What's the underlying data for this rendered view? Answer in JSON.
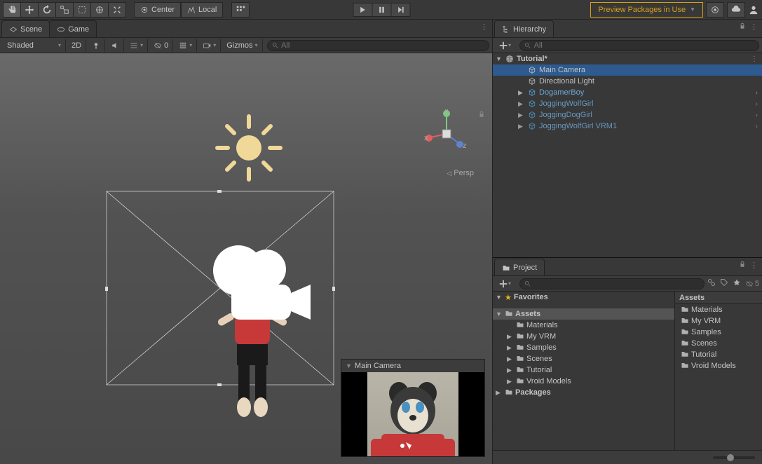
{
  "toolbar": {
    "pivot": "Center",
    "space": "Local",
    "preview_label": "Preview Packages in Use"
  },
  "scene": {
    "tabs": {
      "scene": "Scene",
      "game": "Game"
    },
    "shading": "Shaded",
    "mode_2d": "2D",
    "hidden_icon_count": "0",
    "gizmos": "Gizmos",
    "search_placeholder": "All",
    "persp": "Persp",
    "axes": {
      "x": "x",
      "y": "y",
      "z": "z"
    },
    "camera_preview": "Main Camera"
  },
  "hierarchy": {
    "title": "Hierarchy",
    "search_placeholder": "All",
    "scene": "Tutorial*",
    "items": [
      {
        "label": "Main Camera",
        "type": "go",
        "selected": true,
        "depth": 2
      },
      {
        "label": "Directional Light",
        "type": "go",
        "selected": false,
        "depth": 2
      },
      {
        "label": "DogamerBoy",
        "type": "prefab",
        "selected": false,
        "depth": 2,
        "expandable": true,
        "more": true
      },
      {
        "label": "JoggingWolfGirl",
        "type": "prefab-dim",
        "selected": false,
        "depth": 2,
        "expandable": true,
        "more": true
      },
      {
        "label": "JoggingDogGirl",
        "type": "prefab-dim",
        "selected": false,
        "depth": 2,
        "expandable": true,
        "more": true
      },
      {
        "label": "JoggingWolfGirl VRM1",
        "type": "prefab-dim",
        "selected": false,
        "depth": 2,
        "expandable": true,
        "more": true
      }
    ]
  },
  "project": {
    "title": "Project",
    "hidden_count": "5",
    "favorites": "Favorites",
    "assets": "Assets",
    "packages": "Packages",
    "assets_header": "Assets",
    "tree_folders": [
      "Materials",
      "My VRM",
      "Samples",
      "Scenes",
      "Tutorial",
      "Vroid Models"
    ],
    "content_folders": [
      "Materials",
      "My VRM",
      "Samples",
      "Scenes",
      "Tutorial",
      "Vroid Models"
    ]
  }
}
